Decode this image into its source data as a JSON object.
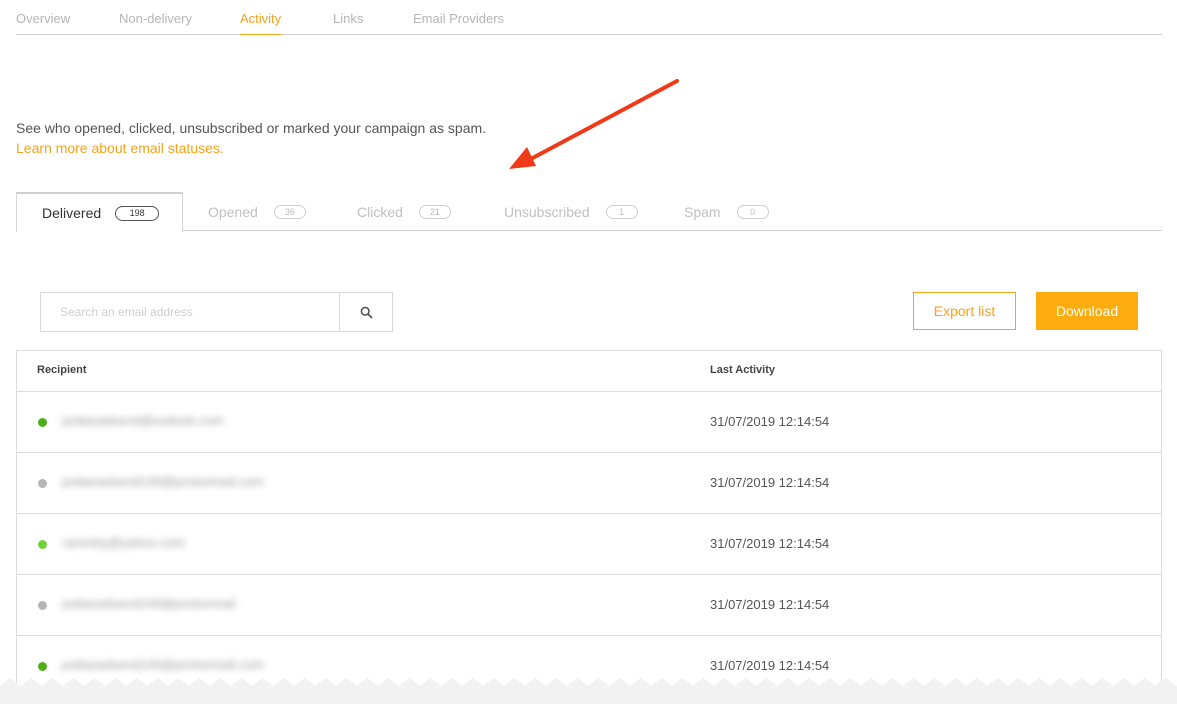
{
  "topnav": {
    "items": [
      {
        "label": "Overview"
      },
      {
        "label": "Non-delivery"
      },
      {
        "label": "Activity"
      },
      {
        "label": "Links"
      },
      {
        "label": "Email Providers"
      }
    ],
    "active": "Activity"
  },
  "intro": {
    "description": "See who opened, clicked, unsubscribed or marked your campaign as spam.",
    "learn_more": "Learn more about email statuses."
  },
  "status_tabs": [
    {
      "label": "Delivered",
      "count": "198"
    },
    {
      "label": "Opened",
      "count": "36"
    },
    {
      "label": "Clicked",
      "count": "21"
    },
    {
      "label": "Unsubscribed",
      "count": "1"
    },
    {
      "label": "Spam",
      "count": "0"
    }
  ],
  "search": {
    "placeholder": "Search an email address",
    "icon": "search-icon"
  },
  "actions": {
    "export_label": "Export list",
    "download_label": "Download"
  },
  "table": {
    "headers": [
      "Recipient",
      "Last Activity"
    ],
    "rows": [
      {
        "email": "pottasadsend@outlook.com",
        "status_color": "#4caf1a",
        "last_activity": "31/07/2019 12:14:54"
      },
      {
        "email": "pottasadsend149@protonmail.com",
        "status_color": "#b5b5b5",
        "last_activity": "31/07/2019 12:14:54"
      },
      {
        "email": "raxonby@yahoo.com",
        "status_color": "#6fd33a",
        "last_activity": "31/07/2019 12:14:54"
      },
      {
        "email": "pottasadsend149@protonmail",
        "status_color": "#b5b5b5",
        "last_activity": "31/07/2019 12:14:54"
      },
      {
        "email": "pottasadsend149@protonmail.com",
        "status_color": "#4caf1a",
        "last_activity": "31/07/2019 12:14:54"
      }
    ]
  },
  "colors": {
    "accent": "#f5a31a",
    "annotation_arrow": "#f03a17"
  }
}
